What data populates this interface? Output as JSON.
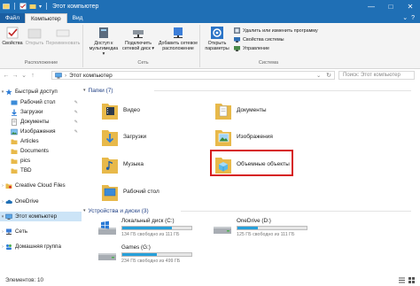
{
  "window": {
    "title": "Этот компьютер",
    "controls": {
      "minimize": "—",
      "maximize": "□",
      "close": "✕"
    }
  },
  "ribbon_tabs": {
    "file": "Файл",
    "items": [
      "Компьютер",
      "Вид"
    ],
    "active": "Компьютер",
    "collapse_glyph": "⌄",
    "help_glyph": "?"
  },
  "ribbon": {
    "groups": {
      "location": "Расположение",
      "network": "Сеть",
      "system": "Система"
    },
    "location": {
      "properties": "Свойства",
      "open": "Открыть",
      "rename": "Переименовать"
    },
    "network": {
      "media_access": "Доступ к мультимедиа ▾",
      "map_drive": "Подключить сетевой диск ▾",
      "add_location": "Добавить сетевое расположение"
    },
    "system": {
      "open_settings": "Открыть параметры",
      "uninstall": "Удалить или изменить программу",
      "system_properties": "Свойства системы",
      "manage": "Управление"
    }
  },
  "address_bar": {
    "back": "←",
    "forward": "→",
    "recent": "⌄",
    "up": "↑",
    "sep": "›",
    "path": "Этот компьютер",
    "dropdown": "⌄",
    "refresh": "↻",
    "search_placeholder": "Поиск: Этот компьютер"
  },
  "nav_pane": {
    "items": [
      {
        "label": "Быстрый доступ",
        "icon": "star-icon",
        "level": 0,
        "pinned": false
      },
      {
        "label": "Рабочий стол",
        "icon": "desktop-folder-icon",
        "level": 1,
        "pinned": true
      },
      {
        "label": "Загрузки",
        "icon": "downloads-folder-icon",
        "level": 1,
        "pinned": true
      },
      {
        "label": "Документы",
        "icon": "documents-folder-icon",
        "level": 1,
        "pinned": true
      },
      {
        "label": "Изображения",
        "icon": "pictures-folder-icon",
        "level": 1,
        "pinned": true
      },
      {
        "label": "Articles",
        "icon": "folder-icon",
        "level": 1,
        "pinned": false
      },
      {
        "label": "Documents",
        "icon": "folder-icon",
        "level": 1,
        "pinned": false
      },
      {
        "label": "pics",
        "icon": "folder-icon",
        "level": 1,
        "pinned": false
      },
      {
        "label": "TBD",
        "icon": "folder-icon",
        "level": 1,
        "pinned": false
      },
      {
        "label": "Creative Cloud Files",
        "icon": "creative-cloud-icon",
        "level": 0,
        "pinned": false
      },
      {
        "label": "OneDrive",
        "icon": "onedrive-cloud-icon",
        "level": 0,
        "pinned": false
      },
      {
        "label": "Этот компьютер",
        "icon": "computer-icon",
        "level": 0,
        "pinned": false,
        "selected": true
      },
      {
        "label": "Сеть",
        "icon": "network-icon",
        "level": 0,
        "pinned": false
      },
      {
        "label": "Домашняя группа",
        "icon": "homegroup-icon",
        "level": 0,
        "pinned": false
      }
    ]
  },
  "main": {
    "folders_header": "Папки (7)",
    "folders": [
      {
        "label": "Видео",
        "icon": "videos-folder-icon"
      },
      {
        "label": "Документы",
        "icon": "documents-folder-icon"
      },
      {
        "label": "Загрузки",
        "icon": "downloads-folder-icon"
      },
      {
        "label": "Изображения",
        "icon": "pictures-folder-icon"
      },
      {
        "label": "Музыка",
        "icon": "music-folder-icon"
      },
      {
        "label": "Объемные объекты",
        "icon": "3d-objects-folder-icon"
      },
      {
        "label": "Рабочий стол",
        "icon": "desktop-folder-icon"
      }
    ],
    "devices_header": "Устройства и диски (3)",
    "drives": [
      {
        "label": "Локальный диск (C:)",
        "free": "134 ГБ свободно из 111 ГБ",
        "used_fraction": 0.72,
        "icon": "windows-drive-icon"
      },
      {
        "label": "OneDrive (D:)",
        "free": "125 ГБ свободно из 111 ГБ",
        "used_fraction": 0.3,
        "icon": "drive-icon"
      },
      {
        "label": "Games (G:)",
        "free": "234 ГБ свободно из 499 ГБ",
        "used_fraction": 0.5,
        "icon": "drive-icon"
      }
    ]
  },
  "status_bar": {
    "items_count": "Элементов: 10"
  },
  "colors": {
    "title_bar": "#1f6fb5",
    "selection": "#cce4f7",
    "highlight_border": "#d61b1b",
    "drive_bar": "#26a0da",
    "folder": "#e8b94a"
  }
}
